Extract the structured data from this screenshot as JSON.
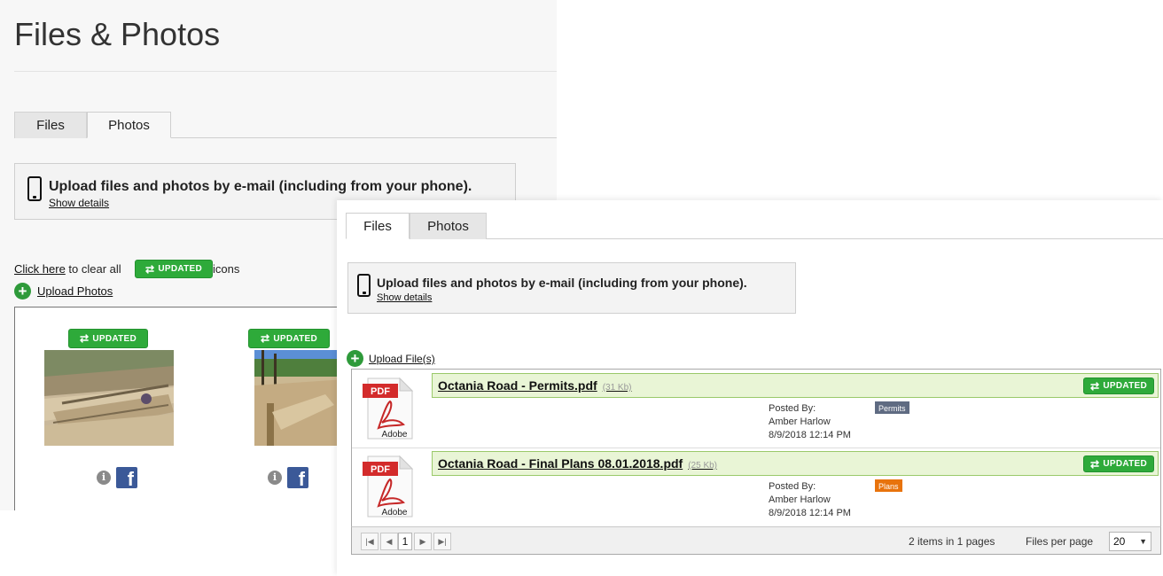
{
  "page_title": "Files & Photos",
  "back_panel": {
    "tabs": [
      {
        "label": "Files",
        "active": false
      },
      {
        "label": "Photos",
        "active": true
      }
    ],
    "email_banner": {
      "title": "Upload files and photos by e-mail (including from your phone).",
      "details_link": "Show details"
    },
    "clear_line": {
      "link": "Click here",
      "text_before": " to clear all ",
      "text_after": " icons"
    },
    "upload_photos_label": "Upload Photos",
    "photos": [
      {
        "badge": "UPDATED"
      },
      {
        "badge": "UPDATED"
      }
    ],
    "info_glyph": "i",
    "facebook_glyph": "f"
  },
  "front_panel": {
    "tabs": [
      {
        "label": "Files",
        "active": true
      },
      {
        "label": "Photos",
        "active": false
      }
    ],
    "email_banner": {
      "title": "Upload files and photos by e-mail (including from your phone).",
      "details_link": "Show details"
    },
    "upload_files_label": "Upload File(s)",
    "files": [
      {
        "name": "Octania Road - Permits.pdf",
        "size": "(31 Kb)",
        "posted_by_label": "Posted By:",
        "author": "Amber Harlow",
        "date": "8/9/2018 12:14 PM",
        "category": "Permits",
        "category_color": "#5f6b82",
        "badge": "UPDATED"
      },
      {
        "name": "Octania Road - Final Plans 08.01.2018.pdf",
        "size": "(25 Kb)",
        "posted_by_label": "Posted By:",
        "author": "Amber Harlow",
        "date": "8/9/2018 12:14 PM",
        "category": "Plans",
        "category_color": "#e8730c",
        "badge": "UPDATED"
      }
    ],
    "pdf_icon": {
      "top_label": "PDF",
      "bottom_label": "Adobe"
    },
    "pager": {
      "current_page": "1",
      "info": "2 items in 1 pages",
      "per_page_label": "Files per page",
      "per_page_value": "20"
    }
  },
  "updated_badge_label": "UPDATED",
  "colors": {
    "accent_green": "#2eaa3a",
    "row_highlight": "#e9f5d6",
    "facebook_blue": "#3b5998"
  }
}
